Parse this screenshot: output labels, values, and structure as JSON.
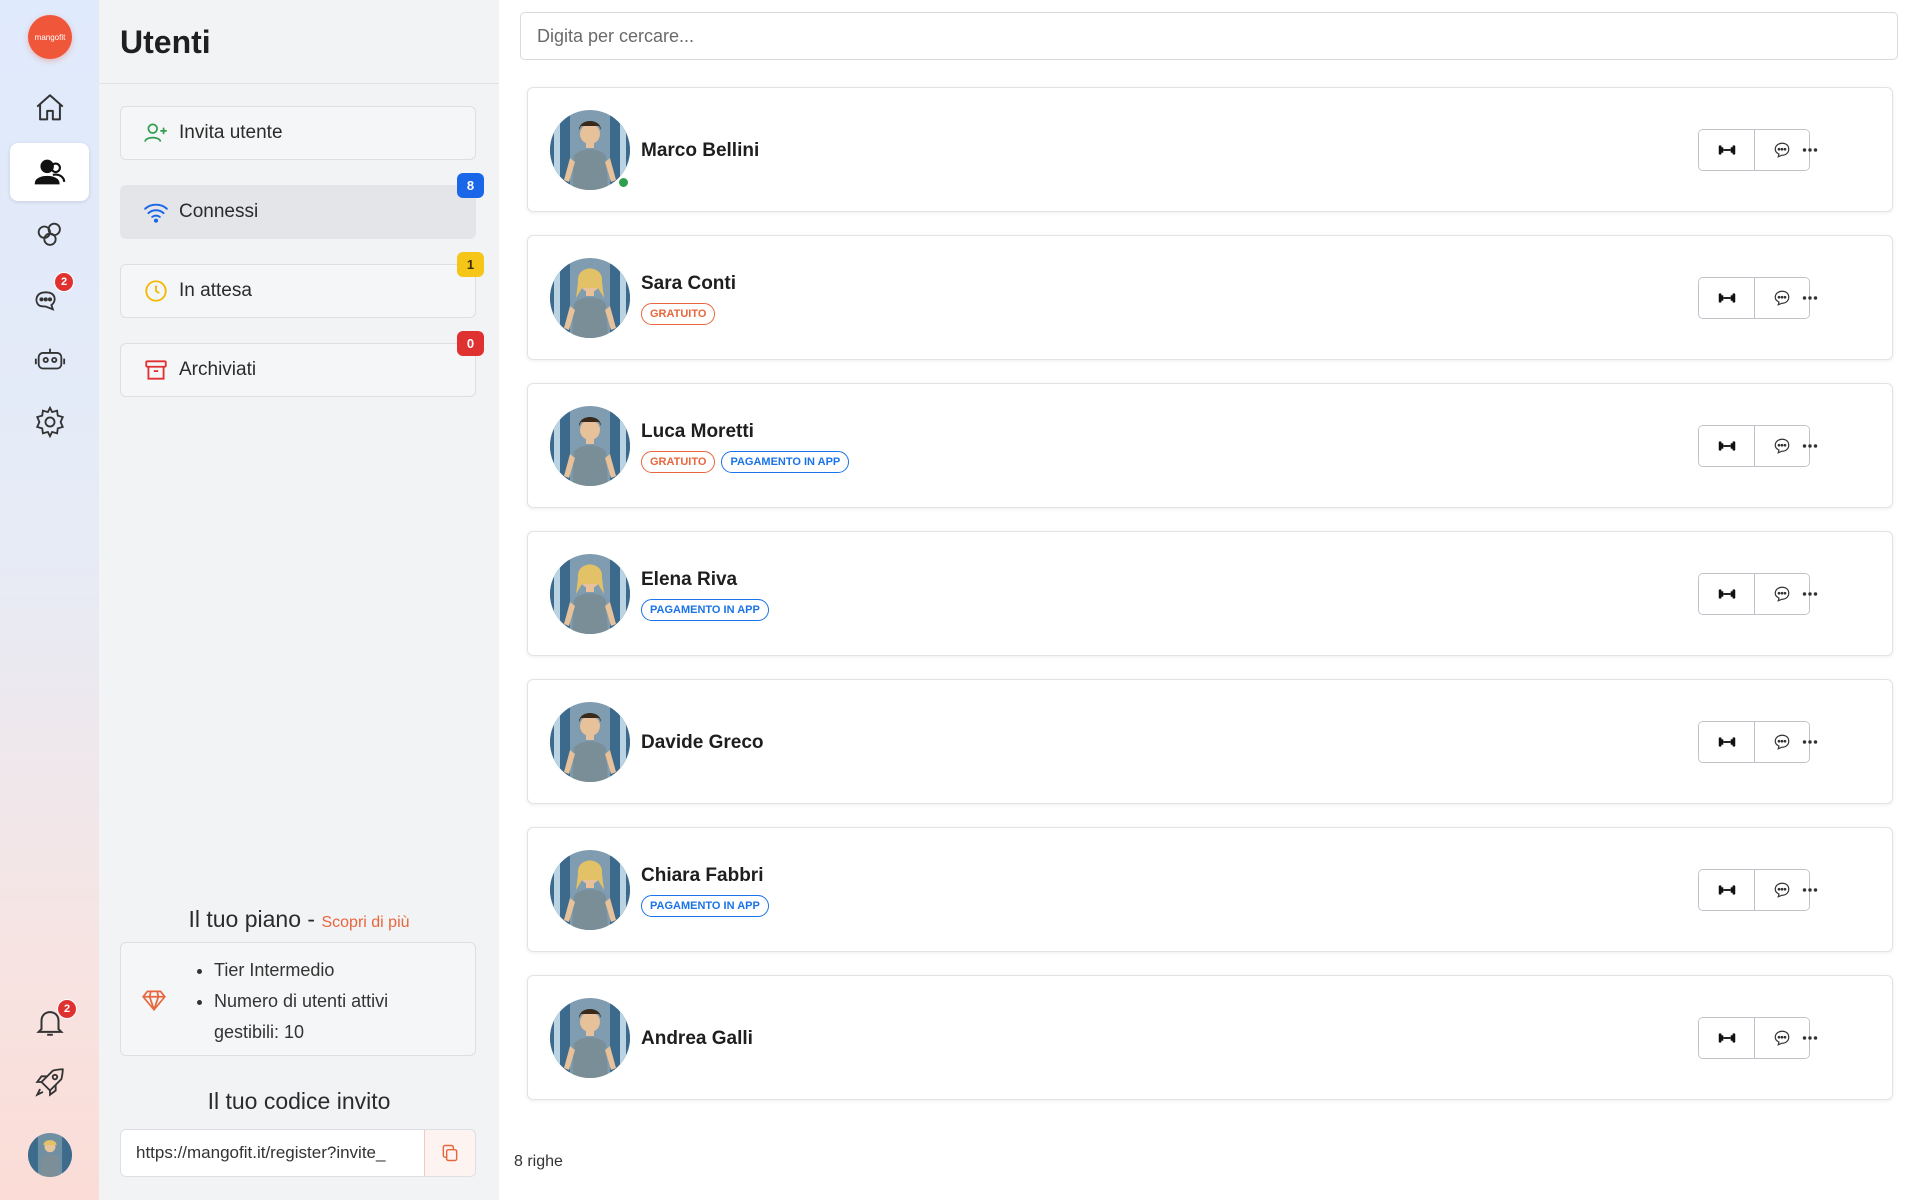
{
  "app": {
    "logo_text": "mangofit"
  },
  "rail": {
    "chat_badge": "2",
    "notification_badge": "2"
  },
  "panel": {
    "title": "Utenti",
    "nav": [
      {
        "label": "Invita utente",
        "badge": ""
      },
      {
        "label": "Connessi",
        "badge": "8",
        "badge_color": "#1a66e8"
      },
      {
        "label": "In attesa",
        "badge": "1",
        "badge_color": "#f5c518"
      },
      {
        "label": "Archiviati",
        "badge": "0",
        "badge_color": "#e03131"
      }
    ],
    "plan": {
      "title": "Il tuo piano",
      "separator": "-",
      "more_link": "Scopri di più",
      "items": [
        "Tier Intermedio",
        "Numero di utenti attivi gestibili: 10"
      ]
    },
    "invite": {
      "title": "Il tuo codice invito",
      "url": "https://mangofit.it/register?invite_"
    }
  },
  "main": {
    "search_placeholder": "Digita per cercare...",
    "row_count": "8 righe",
    "users": [
      {
        "name": "Marco Bellini",
        "tags": [],
        "online": true,
        "gender": "m"
      },
      {
        "name": "Sara Conti",
        "tags": [
          "GRATUITO"
        ],
        "online": false,
        "gender": "f"
      },
      {
        "name": "Luca Moretti",
        "tags": [
          "GRATUITO",
          "PAGAMENTO IN APP"
        ],
        "online": false,
        "gender": "m"
      },
      {
        "name": "Elena Riva",
        "tags": [
          "PAGAMENTO IN APP"
        ],
        "online": false,
        "gender": "f"
      },
      {
        "name": "Davide Greco",
        "tags": [],
        "online": false,
        "gender": "m"
      },
      {
        "name": "Chiara Fabbri",
        "tags": [
          "PAGAMENTO IN APP"
        ],
        "online": false,
        "gender": "f"
      },
      {
        "name": "Andrea Galli",
        "tags": [],
        "online": false,
        "gender": "m"
      }
    ]
  }
}
